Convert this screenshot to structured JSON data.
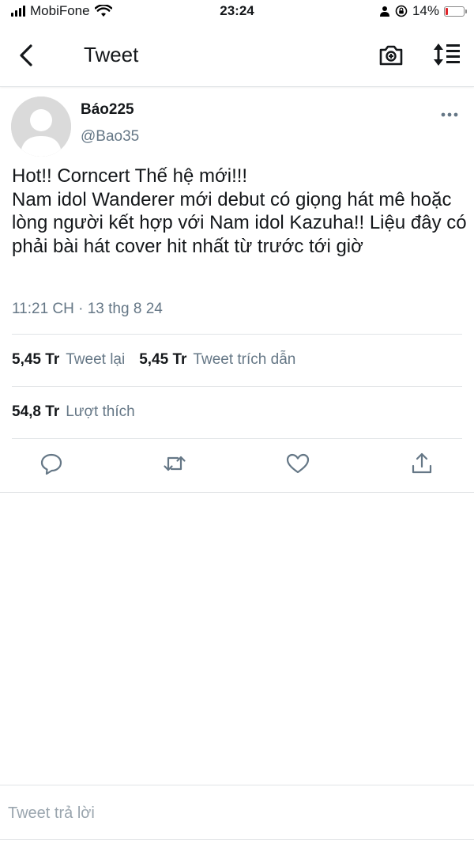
{
  "status_bar": {
    "carrier": "MobiFone",
    "time": "23:24",
    "battery_percent": "14%",
    "battery_level": 0.14,
    "battery_color": "#e0242a"
  },
  "nav": {
    "title": "Tweet",
    "icons": [
      "chevron-left-icon",
      "camera-icon",
      "sort-icon"
    ]
  },
  "tweet": {
    "display_name": "Báo225",
    "handle": "@Bao35",
    "text": "Hot!! Corncert Thế hệ mới!!!\nNam idol Wanderer mới debut có giọng hát mê hoặc lòng người kết hợp với Nam idol Kazuha!! Liệu đây có phải bài hát cover hit nhất từ trước tới giờ",
    "timestamp": "11:21 CH · 13 thg 8 24",
    "stats": {
      "retweets_count": "5,45 Tr",
      "retweets_label": "Tweet lại",
      "quotes_count": "5,45 Tr",
      "quotes_label": "Tweet trích dẫn",
      "likes_count": "54,8 Tr",
      "likes_label": "Lượt thích"
    }
  },
  "reply": {
    "placeholder": "Tweet trả lời"
  },
  "colors": {
    "text_primary": "#14171a",
    "text_secondary": "#657786",
    "divider": "#e1e4e6"
  }
}
